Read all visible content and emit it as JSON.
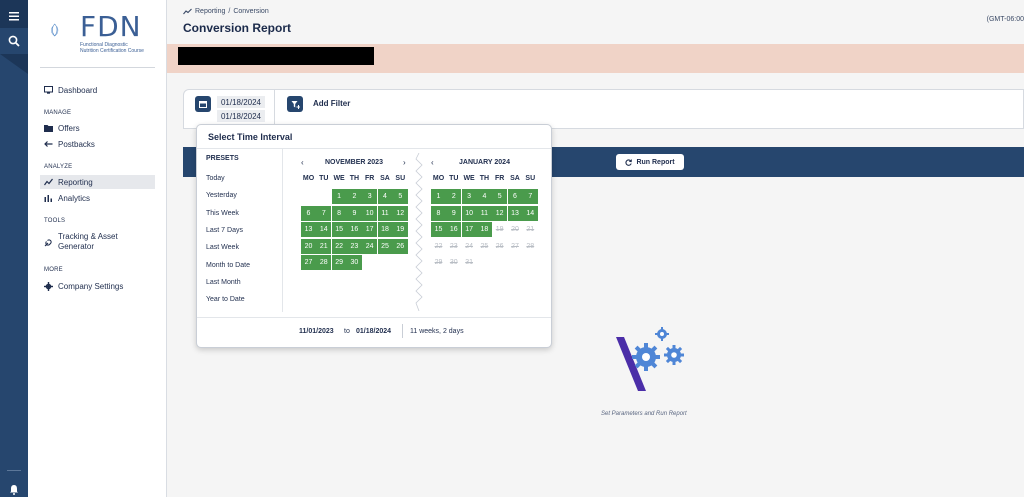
{
  "sidebar": {
    "logo_text": "FDN",
    "logo_sub": "Functional Diagnostic Nutrition Certification Course",
    "items": [
      {
        "label": "Dashboard"
      },
      {
        "section": "MANAGE"
      },
      {
        "label": "Offers"
      },
      {
        "label": "Postbacks"
      },
      {
        "section": "ANALYZE"
      },
      {
        "label": "Reporting"
      },
      {
        "label": "Analytics"
      },
      {
        "section": "TOOLS"
      },
      {
        "label": "Tracking & Asset Generator"
      },
      {
        "section": "MORE"
      },
      {
        "label": "Company Settings"
      }
    ]
  },
  "header": {
    "breadcrumb_parent": "Reporting",
    "breadcrumb_sep": "/",
    "breadcrumb_current": "Conversion",
    "title": "Conversion Report",
    "timezone": "(GMT-06:00"
  },
  "filters": {
    "date_start": "01/18/2024",
    "date_end": "01/18/2024",
    "add_filter_label": "Add Filter",
    "run_report_label": "Run Report"
  },
  "interval_popup": {
    "title": "Select Time Interval",
    "presets_title": "PRESETS",
    "presets": [
      "Today",
      "Yesterday",
      "This Week",
      "Last 7 Days",
      "Last Week",
      "Month to Date",
      "Last Month",
      "Year to Date"
    ],
    "weekdays": [
      "MO",
      "TU",
      "WE",
      "TH",
      "FR",
      "SA",
      "SU"
    ],
    "left_month": "NOVEMBER  2023",
    "right_month": "JANUARY  2024",
    "range_from": "11/01/2023",
    "range_to_label": "to",
    "range_to": "01/18/2024",
    "range_duration": "11 weeks, 2 days"
  },
  "empty_state": {
    "text": "Set Parameters and Run Report"
  },
  "colors": {
    "navy": "#26466e",
    "green_selected": "#4a9b4c",
    "banner": "#f0d3c7"
  }
}
